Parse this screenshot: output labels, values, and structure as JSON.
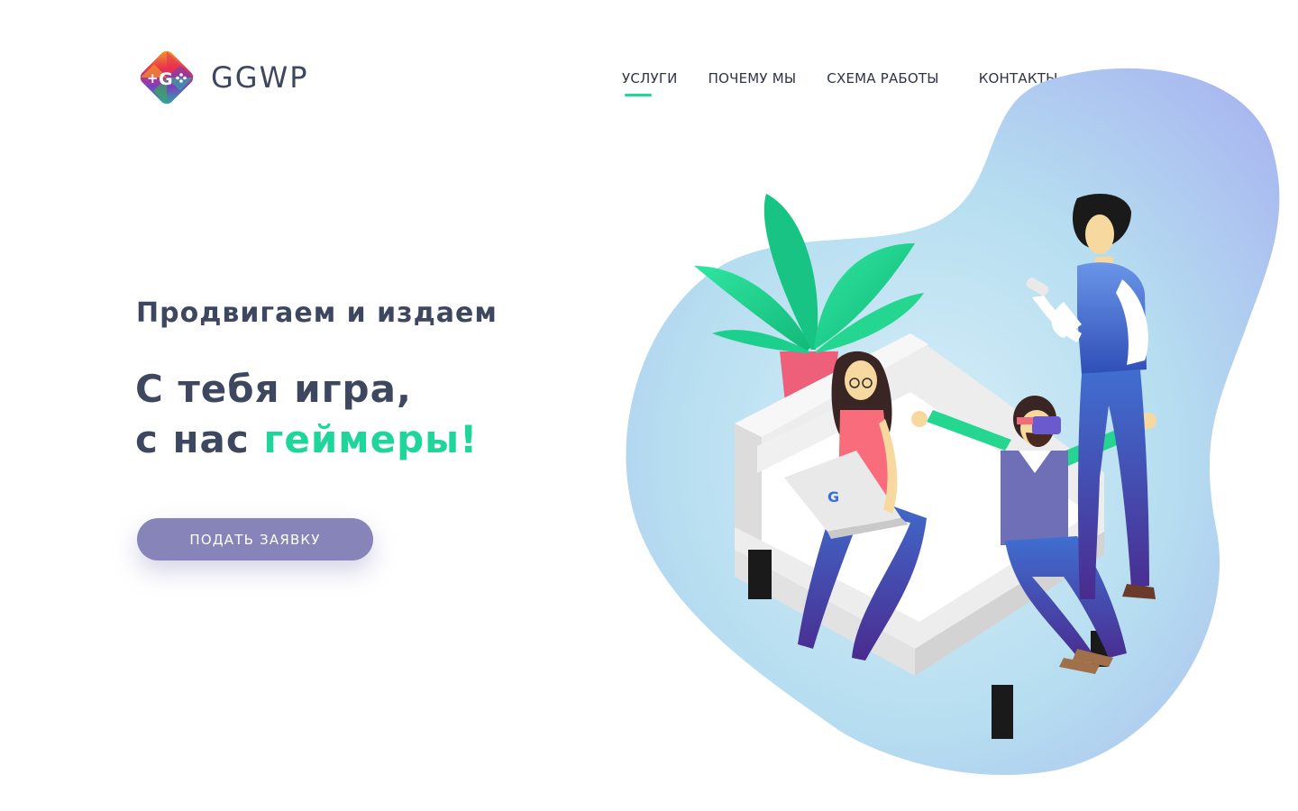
{
  "brand": {
    "name": "GGWP",
    "accent_color": "#1fd69a",
    "button_color": "#8784b9",
    "text_color": "#3d4760"
  },
  "nav": {
    "items": [
      {
        "label": "УСЛУГИ",
        "active": true
      },
      {
        "label": "ПОЧЕМУ МЫ"
      },
      {
        "label": "СХЕМА РАБОТЫ"
      },
      {
        "label": "КОНТАКТЫ"
      }
    ]
  },
  "hero": {
    "subtitle": "Продвигаем и издаем",
    "headline_line1": "С тебя игра,",
    "headline_line2_prefix": "с нас ",
    "headline_line2_accent": "геймеры!",
    "cta_label": "ПОДАТЬ ЗАЯВКУ"
  },
  "illustration": {
    "laptop_logo": "G",
    "icons": [
      "plant-icon",
      "sofa-icon",
      "vr-headset-icon",
      "phone-icon",
      "laptop-icon"
    ]
  }
}
